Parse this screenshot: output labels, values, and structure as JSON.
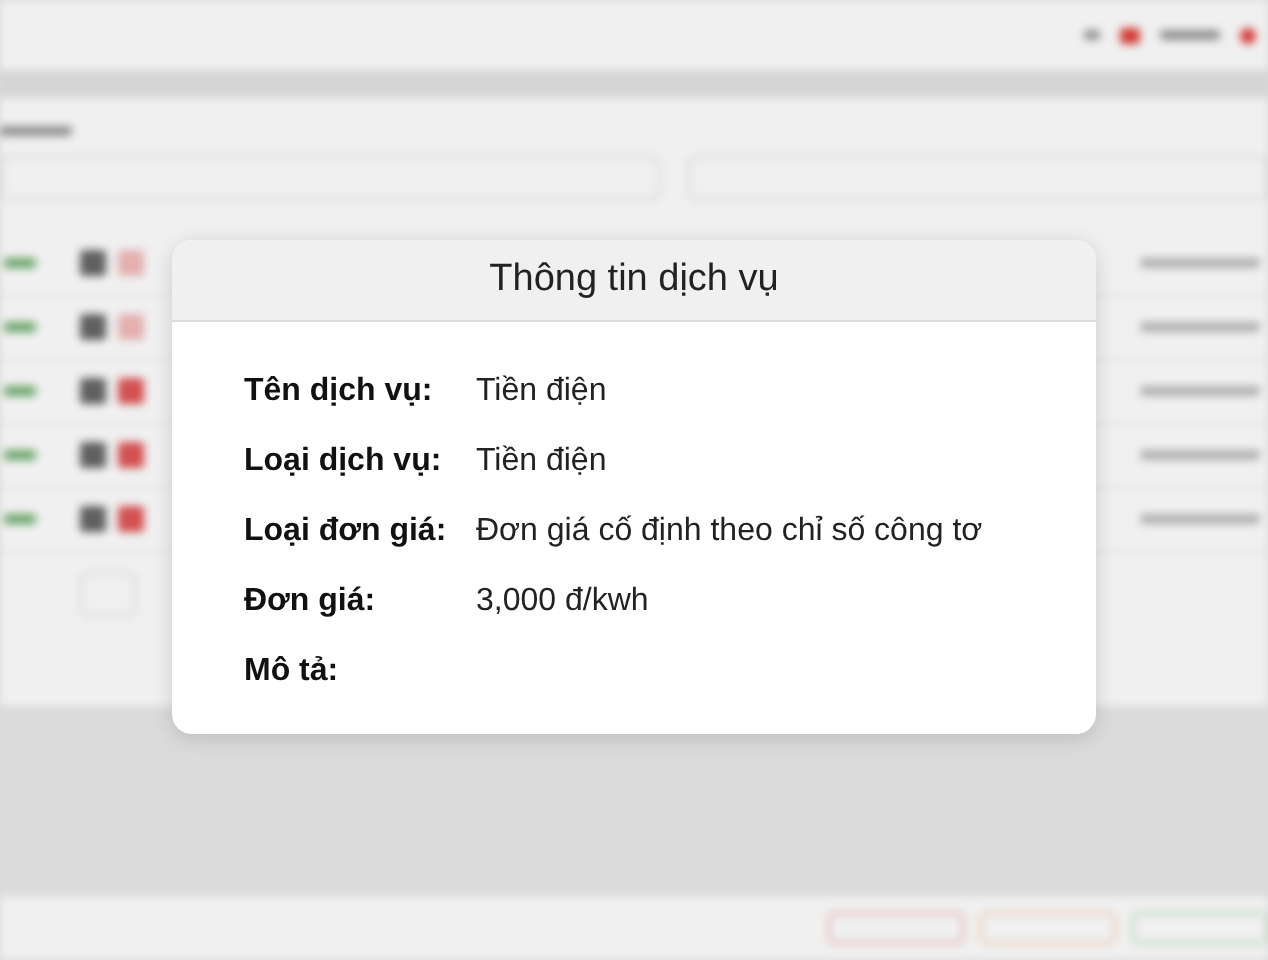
{
  "dialog": {
    "title": "Thông tin dịch vụ",
    "fields": [
      {
        "label": "Tên dịch vụ:",
        "value": "Tiền điện"
      },
      {
        "label": "Loại dịch vụ:",
        "value": "Tiền điện"
      },
      {
        "label": "Loại đơn giá:",
        "value": "Đơn giá cố định theo chỉ số công tơ"
      },
      {
        "label": "Đơn giá:",
        "value": "3,000 đ/kwh"
      },
      {
        "label": "Mô tả:"
      }
    ]
  }
}
